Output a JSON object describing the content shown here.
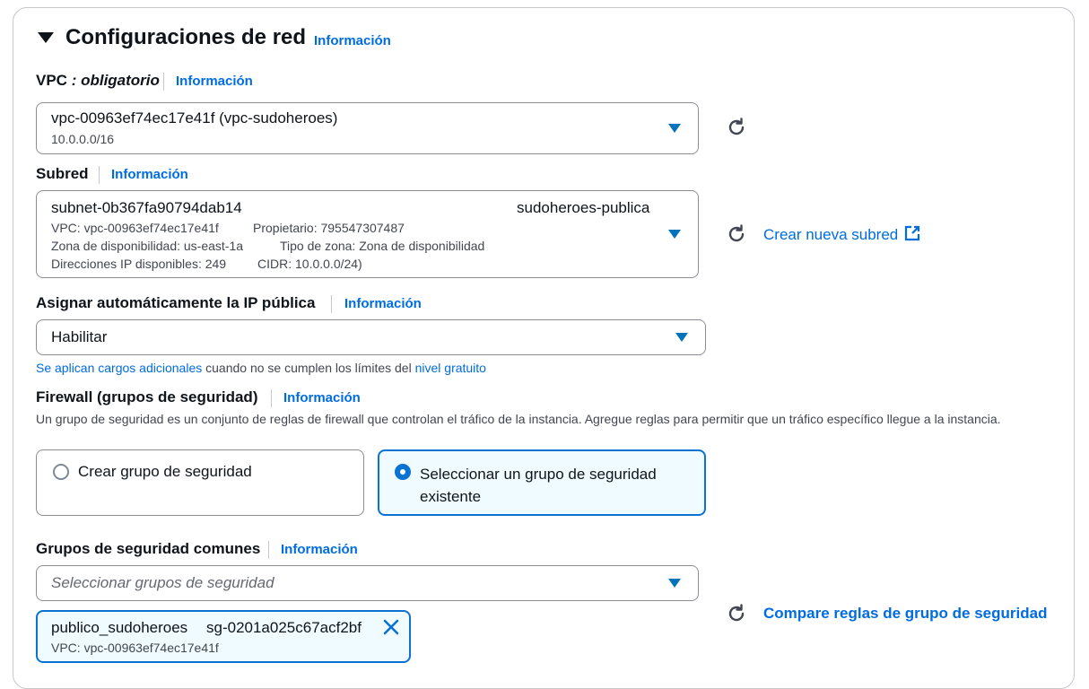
{
  "section": {
    "title": "Configuraciones de red",
    "info": "Información"
  },
  "vpc": {
    "label": "VPC",
    "required": " : obligatorio",
    "info": "Información",
    "value": "vpc-00963ef74ec17e41f (vpc-sudoheroes)",
    "cidr": "10.0.0.0/16"
  },
  "subnet": {
    "label": "Subred",
    "info": "Información",
    "value": "subnet-0b367fa90794dab14",
    "name": "sudoheroes-publica",
    "vpc": "VPC: vpc-00963ef74ec17e41f",
    "owner": "Propietario: 795547307487",
    "az": "Zona de disponibilidad: us-east-1a",
    "zone_type": "Tipo de zona: Zona de disponibilidad",
    "ips": "Direcciones IP disponibles: 249",
    "cidr": "CIDR: 10.0.0.0/24)",
    "create_link": "Crear nueva subred"
  },
  "public_ip": {
    "label": "Asignar automáticamente la IP pública",
    "info": "Información",
    "value": "Habilitar",
    "note_link1": "Se aplican cargos adicionales",
    "note_text": " cuando no se cumplen los límites del ",
    "note_link2": "nivel gratuito"
  },
  "firewall": {
    "label": "Firewall (grupos de seguridad)",
    "info": "Información",
    "description": "Un grupo de seguridad es un conjunto de reglas de firewall que controlan el tráfico de la instancia. Agregue reglas para permitir que un tráfico específico llegue a la instancia.",
    "option_create": "Crear grupo de seguridad",
    "option_select": "Seleccionar un grupo de seguridad existente",
    "selected": "option_select"
  },
  "common_groups": {
    "label": "Grupos de seguridad comunes",
    "info": "Información",
    "placeholder": "Seleccionar grupos de seguridad",
    "compare_link": "Compare reglas de grupo de seguridad",
    "token_name": "publico_sudoheroes",
    "token_id": "sg-0201a025c67acf2bf",
    "token_vpc": "VPC: vpc-00963ef74ec17e41f"
  },
  "colors": {
    "accent": "#006ce0",
    "selected_bg": "#f0fbff",
    "border": "#8c8c94"
  }
}
